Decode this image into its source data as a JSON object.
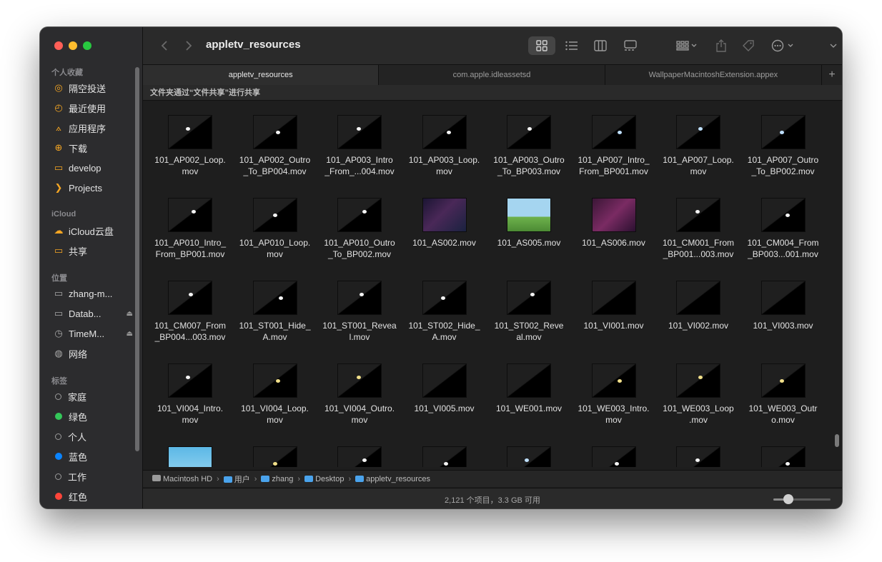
{
  "window": {
    "title": "appletv_resources"
  },
  "sidebar": {
    "favorites_header": "个人收藏",
    "favorites": [
      {
        "label": "隔空投送",
        "icon": "airdrop-icon"
      },
      {
        "label": "最近使用",
        "icon": "clock-icon"
      },
      {
        "label": "应用程序",
        "icon": "applications-icon"
      },
      {
        "label": "下载",
        "icon": "download-icon"
      },
      {
        "label": "develop",
        "icon": "folder-icon"
      },
      {
        "label": "Projects",
        "icon": "projects-icon"
      }
    ],
    "icloud_header": "iCloud",
    "icloud": [
      {
        "label": "iCloud云盘",
        "icon": "cloud-icon"
      },
      {
        "label": "共享",
        "icon": "shared-folder-icon"
      }
    ],
    "locations_header": "位置",
    "locations": [
      {
        "label": "zhang-m...",
        "icon": "laptop-icon"
      },
      {
        "label": "Datab...",
        "icon": "drive-icon",
        "eject": "⏏"
      },
      {
        "label": "TimeM...",
        "icon": "timemachine-icon",
        "eject": "⏏"
      },
      {
        "label": "网络",
        "icon": "network-icon"
      }
    ],
    "tags_header": "标签",
    "tags": [
      {
        "label": "家庭",
        "color": "hollow"
      },
      {
        "label": "绿色",
        "color": "#34c759"
      },
      {
        "label": "个人",
        "color": "hollow"
      },
      {
        "label": "蓝色",
        "color": "#0a84ff"
      },
      {
        "label": "工作",
        "color": "hollow"
      },
      {
        "label": "红色",
        "color": "#ff453a"
      }
    ]
  },
  "tabs": [
    {
      "label": "appletv_resources",
      "active": true
    },
    {
      "label": "com.apple.idleassetsd",
      "active": false
    },
    {
      "label": "WallpaperMacintoshExtension.appex",
      "active": false
    }
  ],
  "share_banner": "文件夹通过“文件共享”进行共享",
  "files": [
    {
      "name": "101_AP002_Loop.\nmov",
      "thumb": "dark-wh"
    },
    {
      "name": "101_AP002_Outro\n_To_BP004.mov",
      "thumb": "dark-wh"
    },
    {
      "name": "101_AP003_Intro\n_From_...004.mov",
      "thumb": "dark-wh"
    },
    {
      "name": "101_AP003_Loop.\nmov",
      "thumb": "dark-wh"
    },
    {
      "name": "101_AP003_Outro\n_To_BP003.mov",
      "thumb": "dark-wh"
    },
    {
      "name": "101_AP007_Intro_\nFrom_BP001.mov",
      "thumb": "dark-bl"
    },
    {
      "name": "101_AP007_Loop.\nmov",
      "thumb": "dark-bl"
    },
    {
      "name": "101_AP007_Outro\n_To_BP002.mov",
      "thumb": "dark-bl"
    },
    {
      "name": "101_AP010_Intro_\nFrom_BP001.mov",
      "thumb": "dark-wh"
    },
    {
      "name": "101_AP010_Loop.\nmov",
      "thumb": "dark-wh"
    },
    {
      "name": "101_AP010_Outro\n_To_BP002.mov",
      "thumb": "dark-wh"
    },
    {
      "name": "101_AS002.mov",
      "thumb": "space"
    },
    {
      "name": "101_AS005.mov",
      "thumb": "park"
    },
    {
      "name": "101_AS006.mov",
      "thumb": "pink"
    },
    {
      "name": "101_CM001_From\n_BP001...003.mov",
      "thumb": "dark-wh"
    },
    {
      "name": "101_CM004_From\n_BP003...001.mov",
      "thumb": "dark-wh"
    },
    {
      "name": "101_CM007_From\n_BP004...003.mov",
      "thumb": "dark-wh"
    },
    {
      "name": "101_ST001_Hide_\nA.mov",
      "thumb": "dark-wh"
    },
    {
      "name": "101_ST001_Revea\nl.mov",
      "thumb": "dark-wh"
    },
    {
      "name": "101_ST002_Hide_\nA.mov",
      "thumb": "dark-wh"
    },
    {
      "name": "101_ST002_Reve\nal.mov",
      "thumb": "dark-wh"
    },
    {
      "name": "101_VI001.mov",
      "thumb": "dark"
    },
    {
      "name": "101_VI002.mov",
      "thumb": "dark"
    },
    {
      "name": "101_VI003.mov",
      "thumb": "dark"
    },
    {
      "name": "101_VI004_Intro.\nmov",
      "thumb": "dark-wh"
    },
    {
      "name": "101_VI004_Loop.\nmov",
      "thumb": "dark-yl"
    },
    {
      "name": "101_VI004_Outro.\nmov",
      "thumb": "dark-yl"
    },
    {
      "name": "101_VI005.mov",
      "thumb": "dark"
    },
    {
      "name": "101_WE001.mov",
      "thumb": "dark"
    },
    {
      "name": "101_WE003_Intro.\nmov",
      "thumb": "dark-yl"
    },
    {
      "name": "101_WE003_Loop\n.mov",
      "thumb": "dark-yl"
    },
    {
      "name": "101_WE003_Outr\no.mov",
      "thumb": "dark-yl"
    },
    {
      "name": "",
      "thumb": "sky"
    },
    {
      "name": "",
      "thumb": "dark-yl"
    },
    {
      "name": "",
      "thumb": "dark-wh"
    },
    {
      "name": "",
      "thumb": "dark-wh"
    },
    {
      "name": "",
      "thumb": "dark-bl"
    },
    {
      "name": "",
      "thumb": "dark-wh"
    },
    {
      "name": "",
      "thumb": "dark-wh"
    },
    {
      "name": "",
      "thumb": "dark-wh"
    }
  ],
  "path": [
    {
      "label": "Macintosh HD",
      "icon": "disk-icon"
    },
    {
      "label": "用户",
      "icon": "folder-icon"
    },
    {
      "label": "zhang",
      "icon": "folder-icon"
    },
    {
      "label": "Desktop",
      "icon": "folder-icon"
    },
    {
      "label": "appletv_resources",
      "icon": "folder-icon"
    }
  ],
  "path_separator": "›",
  "status": "2,121 个项目，3.3 GB 可用"
}
